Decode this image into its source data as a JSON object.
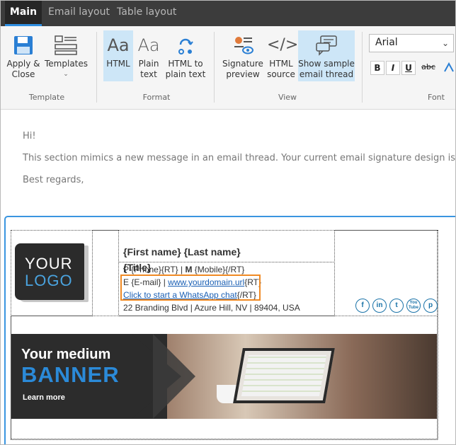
{
  "tabs": [
    {
      "label": "Main",
      "active": true
    },
    {
      "label": "Email layout",
      "active": false
    },
    {
      "label": "Table layout",
      "active": false
    }
  ],
  "ribbon": {
    "template_group": {
      "label": "Template",
      "apply_close": "Apply &\nClose",
      "templates": "Templates"
    },
    "format_group": {
      "label": "Format",
      "html": "HTML",
      "plain_text": "Plain\ntext",
      "html_to_plain": "HTML to\nplain text"
    },
    "view_group": {
      "label": "View",
      "signature_preview": "Signature\npreview",
      "html_source": "HTML\nsource",
      "show_thread": "Show sample\nemail thread"
    },
    "font_group": {
      "label": "Font",
      "font_name": "Arial",
      "bold": "B",
      "italic": "I",
      "underline": "U",
      "strike": "abc"
    }
  },
  "message": {
    "greeting": "Hi!",
    "body": "This section mimics a new message in an email thread. Your current email signature design is shown",
    "closing": "Best regards,"
  },
  "signature": {
    "logo_line1": "YOUR",
    "logo_line2": "LOGO",
    "name": "{First name} {Last name}",
    "title": "{Title}",
    "phone_label": "P",
    "phone_value": "{Phone}{RT} |",
    "mobile_label": "M",
    "mobile_value": "{Mobile}{/RT}",
    "email_label": "E",
    "email_value": "{E-mail} |",
    "url": "www.yourdomain.url",
    "url_suffix": "{RT}",
    "whatsapp": "Click to start a WhatsApp chat",
    "whatsapp_suffix": "{/RT}",
    "address": "22 Branding Blvd | Azure Hill, NV | 89404, USA",
    "social": [
      "f",
      "in",
      "t",
      "You\nTube",
      "p"
    ],
    "banner_line1": "Your medium",
    "banner_line2": "BANNER",
    "banner_cta": "Learn more"
  },
  "colors": {
    "accent": "#2e8ee0",
    "highlight": "#f08a24",
    "link": "#1a5fb4"
  }
}
